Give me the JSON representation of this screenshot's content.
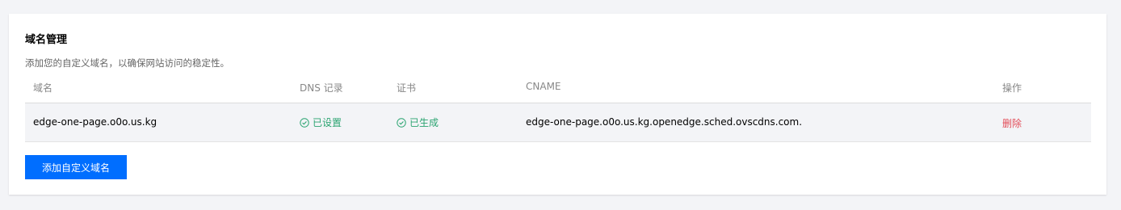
{
  "section": {
    "title": "域名管理",
    "description": "添加您的自定义域名，以确保网站访问的稳定性。"
  },
  "table": {
    "headers": {
      "domain": "域名",
      "dns": "DNS 记录",
      "cert": "证书",
      "cname": "CNAME",
      "actions": "操作"
    },
    "rows": [
      {
        "domain": "edge-one-page.o0o.us.kg",
        "dns_status": "已设置",
        "cert_status": "已生成",
        "cname": "edge-one-page.o0o.us.kg.openedge.sched.ovscdns.com.",
        "action_delete": "删除"
      }
    ]
  },
  "add_button_label": "添加自定义域名",
  "colors": {
    "accent": "#006eff",
    "success": "#2ba471",
    "danger": "#e34d59"
  },
  "icons": {
    "status": "check-circle-icon"
  }
}
